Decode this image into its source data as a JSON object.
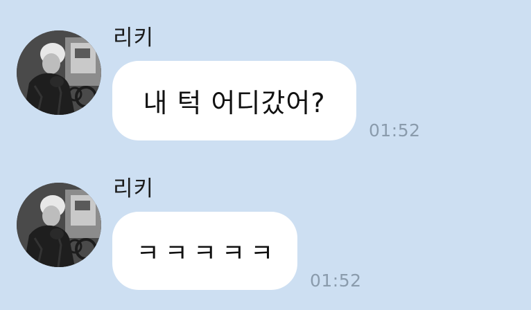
{
  "messages": [
    {
      "sender": "리키",
      "text": "내 턱 어디갔어?",
      "time": "01:52"
    },
    {
      "sender": "리키",
      "text": "ㅋㅋㅋㅋㅋ",
      "time": "01:52"
    }
  ],
  "theme": {
    "background": "#cddff2",
    "bubble": "#ffffff",
    "time_color": "#8a9bac"
  },
  "icons": {
    "avatar": "profile-photo-avatar"
  }
}
